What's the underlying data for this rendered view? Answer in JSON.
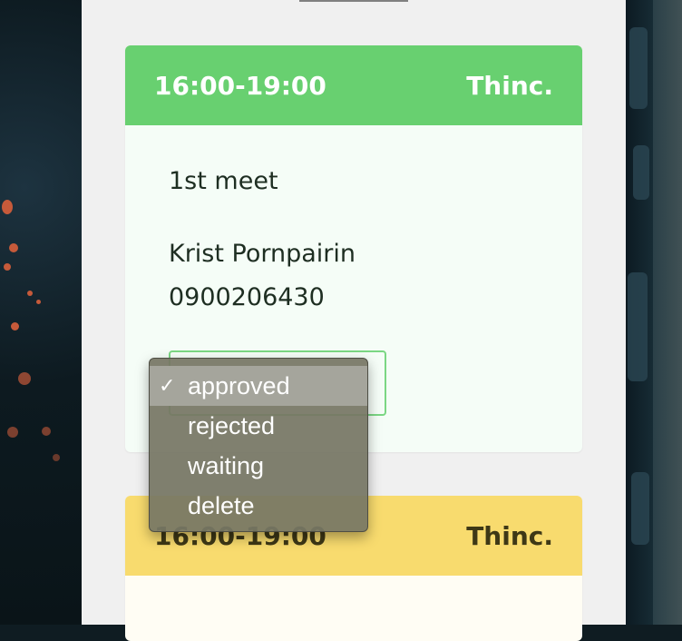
{
  "cards": [
    {
      "time": "16:00-19:00",
      "company": "Thinc.",
      "title": "1st meet",
      "name": "Krist Pornpairin",
      "phone": "0900206430",
      "color": "#68d070"
    },
    {
      "time": "16:00-19:00",
      "company": "Thinc.",
      "color": "#f8db6e"
    }
  ],
  "status_dropdown": {
    "selected": "approved",
    "options": [
      "approved",
      "rejected",
      "waiting",
      "delete"
    ],
    "check_icon": "checkmark-icon"
  }
}
